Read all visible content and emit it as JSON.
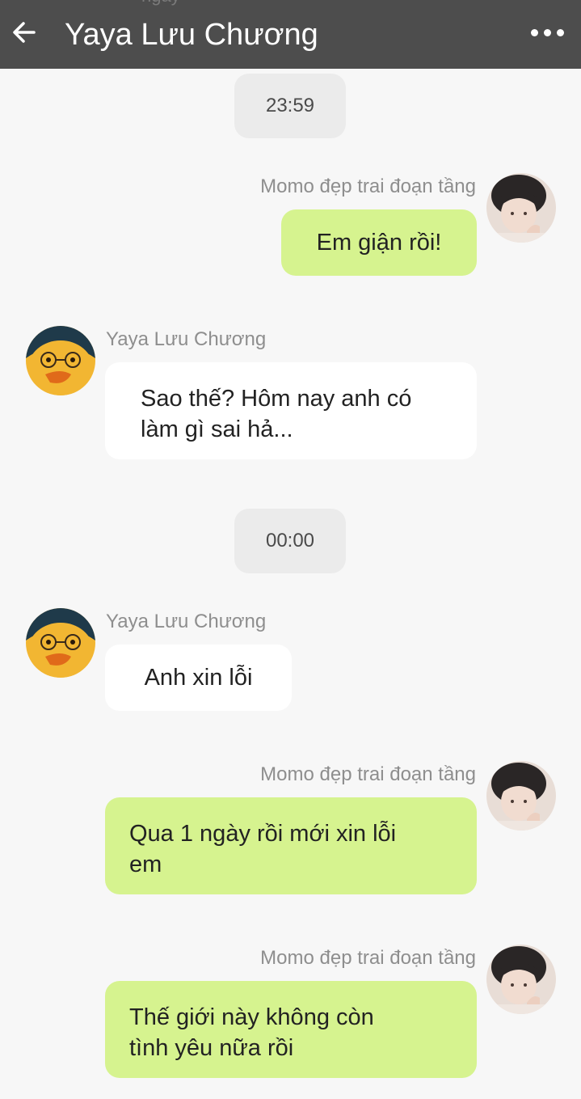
{
  "header": {
    "peek_text": "ngày",
    "title": "Yaya Lưu Chương",
    "back_icon": "arrow-left-icon",
    "more_icon": "more-horizontal-icon"
  },
  "colors": {
    "header_bg": "#4d4d4d",
    "page_bg": "#f7f7f7",
    "sent_bubble": "#d6f38f",
    "received_bubble": "#ffffff",
    "time_pill": "#ebebeb",
    "name_text": "#8e8e8e"
  },
  "messages": [
    {
      "type": "time",
      "text": "23:59"
    },
    {
      "type": "sent",
      "sender": "Momo đẹp trai đoạn tầng",
      "text": "Em giận rồi!"
    },
    {
      "type": "received",
      "sender": "Yaya Lưu Chương",
      "text_line1": "Sao thế? Hôm nay anh có",
      "text_line2": "làm gì sai hả..."
    },
    {
      "type": "time",
      "text": "00:00"
    },
    {
      "type": "received",
      "sender": "Yaya Lưu Chương",
      "text": "Anh xin lỗi"
    },
    {
      "type": "sent",
      "sender": "Momo đẹp trai đoạn tầng",
      "text_line1": "Qua 1 ngày rồi mới xin lỗi",
      "text_line2": "em"
    },
    {
      "type": "sent",
      "sender": "Momo đẹp trai đoạn tầng",
      "text_line1": "Thế giới này không còn",
      "text_line2": "tình yêu nữa rồi"
    }
  ]
}
